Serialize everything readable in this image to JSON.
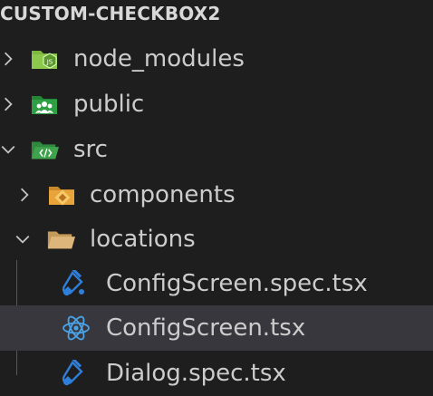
{
  "explorer": {
    "root_title": "CUSTOM-CHECKBOX2",
    "items": [
      {
        "label": "node_modules",
        "kind": "folder",
        "expanded": false,
        "icon": "nodejs-folder-icon",
        "color": "#8cc84b"
      },
      {
        "label": "public",
        "kind": "folder",
        "expanded": false,
        "icon": "public-folder-icon",
        "color": "#2ea043"
      },
      {
        "label": "src",
        "kind": "folder",
        "expanded": true,
        "icon": "src-folder-icon",
        "color": "#3fa34d"
      },
      {
        "label": "components",
        "kind": "folder",
        "expanded": false,
        "icon": "components-folder-icon",
        "color": "#e8a33a"
      },
      {
        "label": "locations",
        "kind": "folder",
        "expanded": true,
        "icon": "folder-open-icon",
        "color": "#dcb67a"
      },
      {
        "label": "ConfigScreen.spec.tsx",
        "kind": "file",
        "icon": "test-tsx-icon",
        "color": "#2f7ed8"
      },
      {
        "label": "ConfigScreen.tsx",
        "kind": "file",
        "selected": true,
        "icon": "react-icon",
        "color": "#4aa3e6"
      },
      {
        "label": "Dialog.spec.tsx",
        "kind": "file",
        "icon": "test-tsx-icon",
        "color": "#2f7ed8"
      }
    ]
  }
}
